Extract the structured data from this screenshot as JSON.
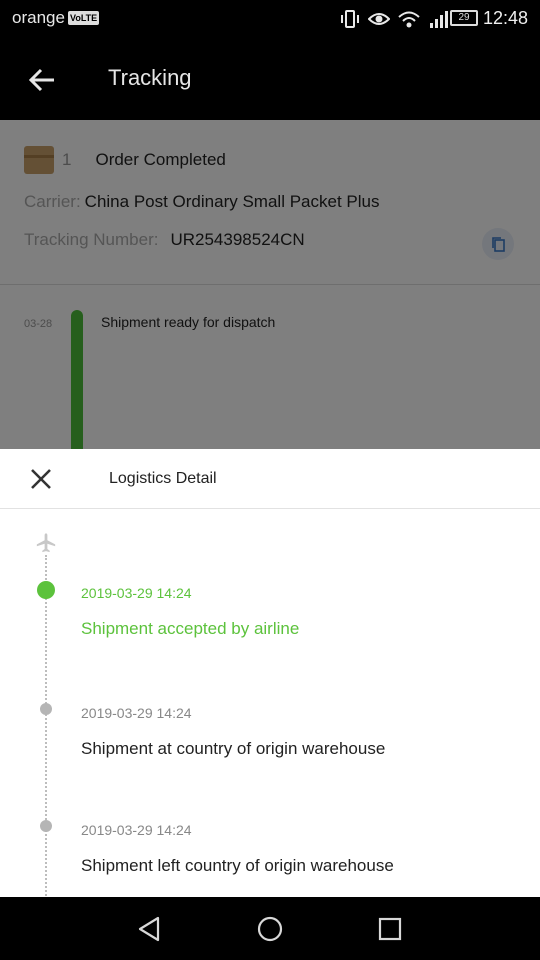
{
  "status_bar": {
    "carrier": "orange",
    "volte_badge": "VoLTE",
    "battery_level": "29",
    "time": "12:48",
    "icons": [
      "vibrate-icon",
      "eye-icon",
      "wifi-icon",
      "signal-icon",
      "battery-icon"
    ]
  },
  "app_bar": {
    "title": "Tracking",
    "back_icon": "arrow-left-icon"
  },
  "order": {
    "number": "1",
    "status": "Order Completed",
    "carrier_label": "Carrier:",
    "carrier_value": "China Post Ordinary Small Packet Plus",
    "tracking_label": "Tracking Number:",
    "tracking_value": "UR254398524CN",
    "copy_icon": "copy-icon"
  },
  "background_timeline": {
    "date": "03-28",
    "text": "Shipment ready for dispatch"
  },
  "sheet": {
    "title": "Logistics Detail",
    "close_icon": "close-icon",
    "events": [
      {
        "time": "2019-03-29 14:24",
        "description": "Shipment accepted by airline",
        "active": true
      },
      {
        "time": "2019-03-29 14:24",
        "description": "Shipment at country of origin warehouse",
        "active": false
      },
      {
        "time": "2019-03-29 14:24",
        "description": "Shipment left country of origin warehouse",
        "active": false
      }
    ]
  },
  "colors": {
    "accent_green": "#5cc23c",
    "timeline_bar_green": "#4cbe3a",
    "inactive_dot": "#b5b5b5"
  },
  "nav_bar": {
    "buttons": [
      "back-triangle-icon",
      "home-circle-icon",
      "recents-square-icon"
    ]
  }
}
